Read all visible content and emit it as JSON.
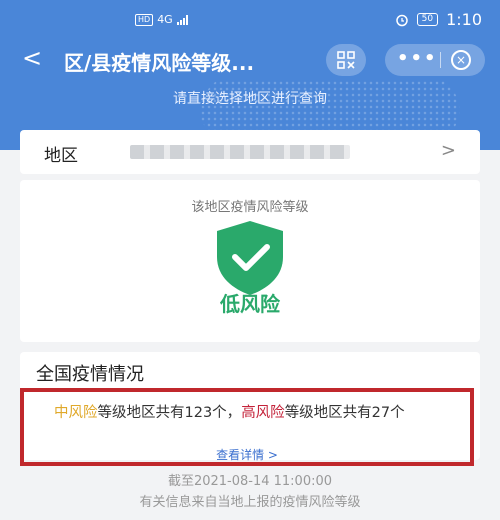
{
  "status_bar": {
    "hd": "HD",
    "network": "4G",
    "battery": "50",
    "time": "1:10",
    "icons": [
      "signal-icon",
      "alarm-icon",
      "battery-icon"
    ]
  },
  "nav": {
    "back_glyph": "<",
    "title": "区/县疫情风险等级...",
    "more_glyph": "•••",
    "close_glyph": "×",
    "icons": [
      "back-icon",
      "qr-scan-icon",
      "more-icon",
      "close-icon"
    ]
  },
  "banner": {
    "hint": "请直接选择地区进行查询"
  },
  "region": {
    "label": "地区",
    "chevron": ">"
  },
  "risk": {
    "title": "该地区疫情风险等级",
    "level": "低风险",
    "level_color": "#2aa96b",
    "icon": "shield-check-icon"
  },
  "nation": {
    "title": "全国疫情情况",
    "medium_label": "中风险",
    "medium_text": "等级地区共有123个，",
    "high_label": "高风险",
    "high_text": "等级地区共有27个",
    "detail_link": "查看详情 >",
    "medium_color": "#e0a92b",
    "high_color": "#c4233a"
  },
  "footer": {
    "timestamp": "截至2021-08-14 11:00:00",
    "note": "有关信息来自当地上报的疫情风险等级"
  },
  "colors": {
    "primary": "#4a86d8",
    "highlight_border": "#c0282c"
  }
}
